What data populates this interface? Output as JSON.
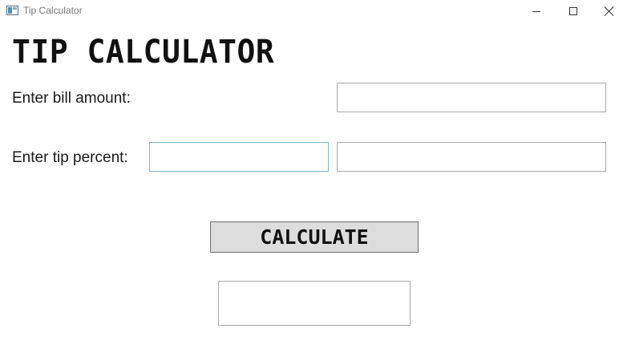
{
  "window": {
    "title": "Tip Calculator",
    "icon": "app-window-icon",
    "controls": {
      "minimize": "minimize-icon",
      "maximize": "maximize-icon",
      "close": "close-icon"
    }
  },
  "main": {
    "heading": "TIP CALCULATOR",
    "bill_label": "Enter bill amount:",
    "bill_value": "",
    "tip_label": "Enter tip percent:",
    "tip_percent_value": "",
    "tip_amount_value": "",
    "calculate_label": "CALCULATE",
    "result_value": ""
  },
  "colors": {
    "focused_border": "#7eb4c9",
    "button_background": "#dddddd",
    "textbox_border": "#a9a9a9"
  }
}
